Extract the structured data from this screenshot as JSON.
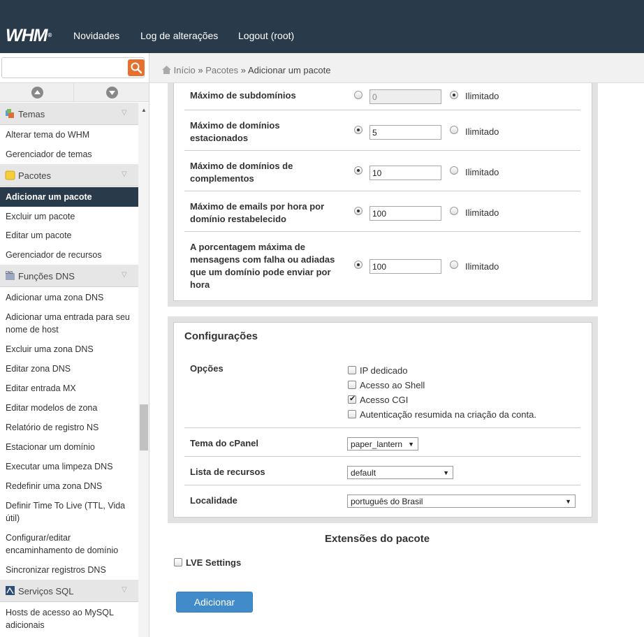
{
  "topbar": {
    "logo": "WHM",
    "nav": [
      "Novidades",
      "Log de alterações",
      "Logout (root)"
    ]
  },
  "sidebar": {
    "search_placeholder": "",
    "sections": [
      {
        "label": "Temas",
        "icon": "themes-icon",
        "items": [
          "Alterar tema do WHM",
          "Gerenciador de temas"
        ]
      },
      {
        "label": "Pacotes",
        "icon": "folder-icon",
        "items": [
          "Adicionar um pacote",
          "Excluir um pacote",
          "Editar um pacote",
          "Gerenciador de recursos"
        ]
      },
      {
        "label": "Funções DNS",
        "icon": "dns-icon",
        "items": [
          "Adicionar uma zona DNS",
          "Adicionar uma entrada para seu nome de host",
          "Excluir uma zona DNS",
          "Editar zona DNS",
          "Editar entrada MX",
          "Editar modelos de zona",
          "Relatório de registro NS",
          "Estacionar um domínio",
          "Executar uma limpeza DNS",
          "Redefinir uma zona DNS",
          "Definir Time To Live (TTL, Vida útil)",
          "Configurar/editar encaminhamento de domínio",
          "Sincronizar registros DNS"
        ]
      },
      {
        "label": "Serviços SQL",
        "icon": "sql-icon",
        "items": [
          "Hosts de acesso ao MySQL adicionais"
        ]
      }
    ],
    "active_item": "Adicionar um pacote"
  },
  "breadcrumb": {
    "home": "Início",
    "sep": "»",
    "level2": "Pacotes",
    "current": "Adicionar um pacote"
  },
  "limits": {
    "unlimited_label": "Ilimitado",
    "rows": [
      {
        "label": "Máximo de subdomínios",
        "value": "0",
        "unlimited": true
      },
      {
        "label": "Máximo de domínios estacionados",
        "value": "5",
        "unlimited": false
      },
      {
        "label": "Máximo de domínios de complementos",
        "value": "10",
        "unlimited": false
      },
      {
        "label": "Máximo de emails por hora por domínio restabelecido",
        "value": "100",
        "unlimited": false
      },
      {
        "label": "A porcentagem máxima de mensagens com falha ou adiadas que um domínio pode enviar por hora",
        "value": "100",
        "unlimited": false
      }
    ]
  },
  "settings": {
    "title": "Configurações",
    "options_label": "Opções",
    "options": [
      {
        "label": "IP dedicado",
        "checked": false
      },
      {
        "label": "Acesso ao Shell",
        "checked": false
      },
      {
        "label": "Acesso CGI",
        "checked": true
      },
      {
        "label": "Autenticação resumida na criação da conta.",
        "checked": false
      }
    ],
    "theme_label": "Tema do cPanel",
    "theme_value": "paper_lantern",
    "feature_list_label": "Lista de recursos",
    "feature_list_value": "default",
    "locale_label": "Localidade",
    "locale_value": "português do Brasil"
  },
  "extensions": {
    "title": "Extensões do pacote",
    "lve_label": "LVE Settings",
    "lve_checked": false
  },
  "submit_label": "Adicionar"
}
